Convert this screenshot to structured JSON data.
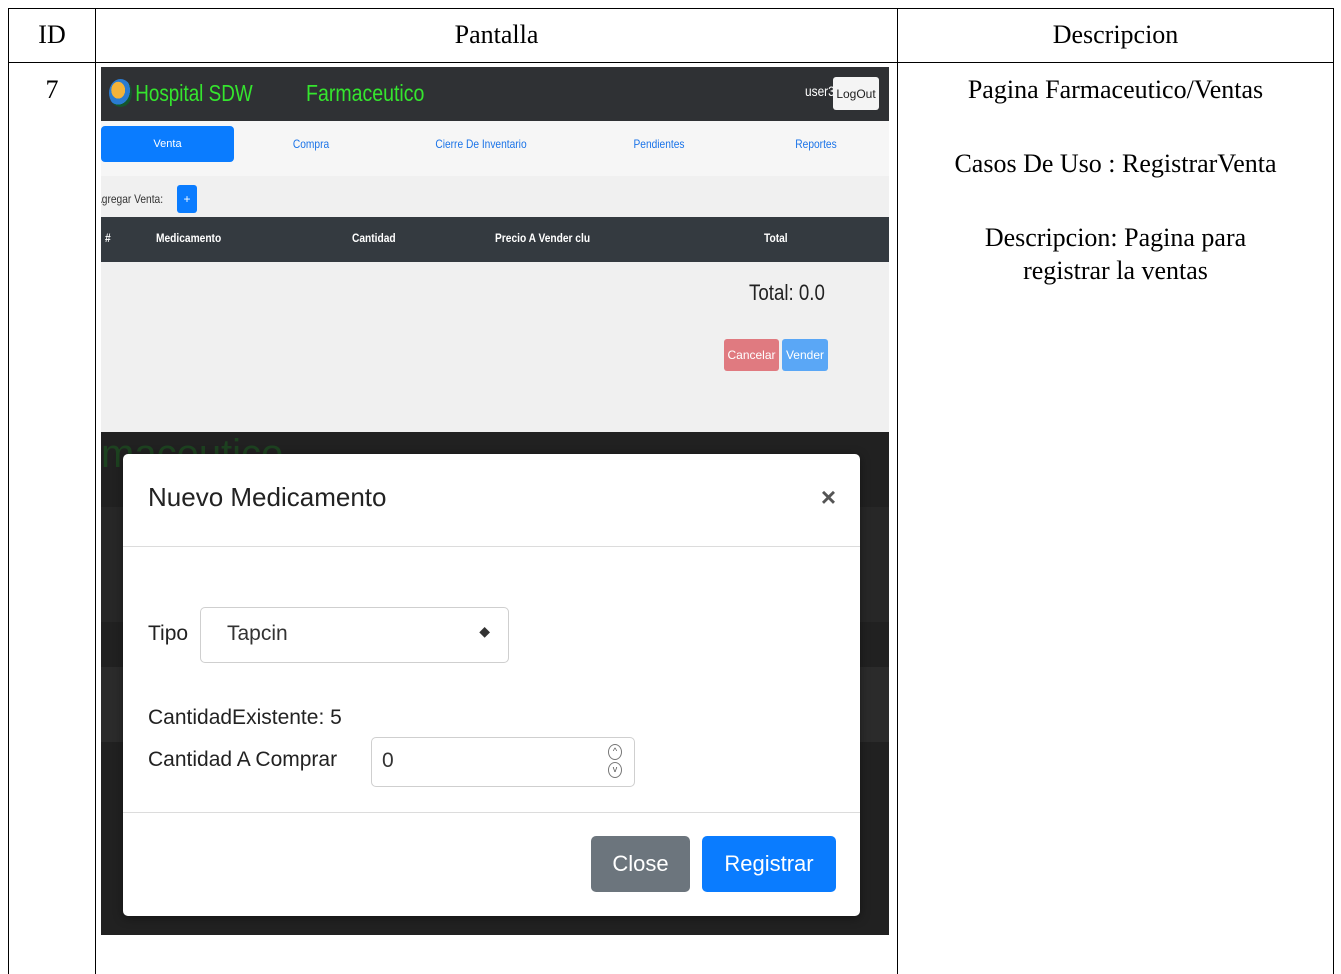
{
  "table": {
    "headers": {
      "id": "ID",
      "pantalla": "Pantalla",
      "descripcion": "Descripcion"
    },
    "row": {
      "id": "7",
      "description_lines": [
        "Pagina Farmaceutico/Ventas",
        "Casos De Uso : RegistrarVenta",
        "Descripcion: Pagina para",
        "registrar la ventas"
      ]
    }
  },
  "app": {
    "brand": "Hospital SDW",
    "section": "Farmaceutico",
    "user": "user3",
    "logout": "LogOut",
    "nav": [
      "Venta",
      "Compra",
      "Cierre De Inventario",
      "Pendientes",
      "Reportes"
    ],
    "add_label": "Agregar Venta:",
    "add_button": "+",
    "columns": [
      "#",
      "Medicamento",
      "Cantidad",
      "Precio A Vender clu",
      "Total"
    ],
    "total": "Total: 0.0",
    "cancel": "Cancelar",
    "sell": "Vender",
    "ghost_title": "maceutico"
  },
  "modal": {
    "title": "Nuevo Medicamento",
    "close_symbol": "×",
    "tipo_label": "Tipo",
    "tipo_value": "Tapcin",
    "cantidad_existente": "CantidadExistente: 5",
    "cantidad_label": "Cantidad A Comprar",
    "cantidad_value": "0",
    "close_button": "Close",
    "register_button": "Registrar"
  },
  "colors": {
    "brand_green": "#35e52e",
    "primary": "#0a7cff",
    "danger": "#e07a80",
    "secondary": "#6c757d"
  }
}
